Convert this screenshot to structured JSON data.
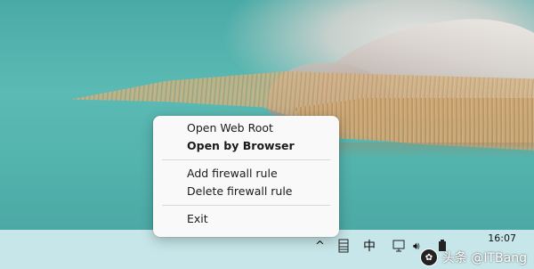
{
  "context_menu": {
    "items": [
      {
        "label": "Open Web Root"
      },
      {
        "label": "Open by Browser"
      },
      {
        "label": "Add firewall rule"
      },
      {
        "label": "Delete firewall rule"
      },
      {
        "label": "Exit"
      }
    ]
  },
  "taskbar": {
    "tray": {
      "chevron": "^",
      "input_method": "中",
      "volume": "🔊︎"
    },
    "clock": {
      "time": "16:07",
      "date": ""
    }
  },
  "watermark": {
    "text": "头条 @ITBang"
  }
}
